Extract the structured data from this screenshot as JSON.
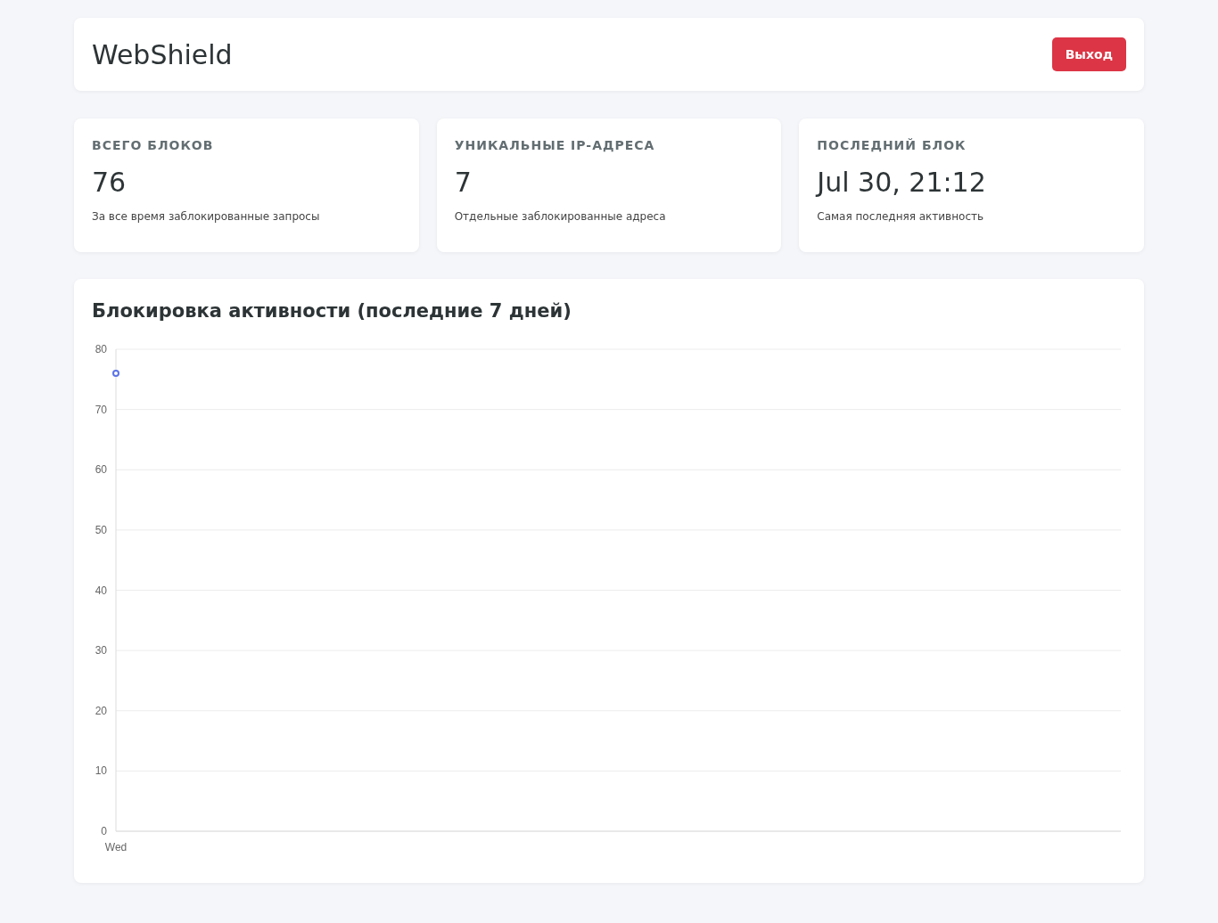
{
  "header": {
    "title": "WebShield",
    "logout_button": "Выход"
  },
  "stats": [
    {
      "label": "ВСЕГО БЛОКОВ",
      "value": "76",
      "description": "За все время заблокированные запросы"
    },
    {
      "label": "УНИКАЛЬНЫЕ IP-АДРЕСА",
      "value": "7",
      "description": "Отдельные заблокированные адреса"
    },
    {
      "label": "ПОСЛЕДНИЙ БЛОК",
      "value": "Jul 30, 21:12",
      "description": "Самая последняя активность"
    }
  ],
  "activity": {
    "title": "Блокировка активности (последние 7 дней)",
    "chart_data": {
      "type": "line",
      "categories": [
        "Wed"
      ],
      "series": [
        {
          "color": "#5b73e8",
          "marker": true,
          "values": [
            76
          ]
        }
      ],
      "grid": true,
      "ylim": [
        0,
        80
      ],
      "yticks": [
        0,
        10,
        20,
        30,
        40,
        50,
        60,
        70,
        80
      ]
    }
  }
}
